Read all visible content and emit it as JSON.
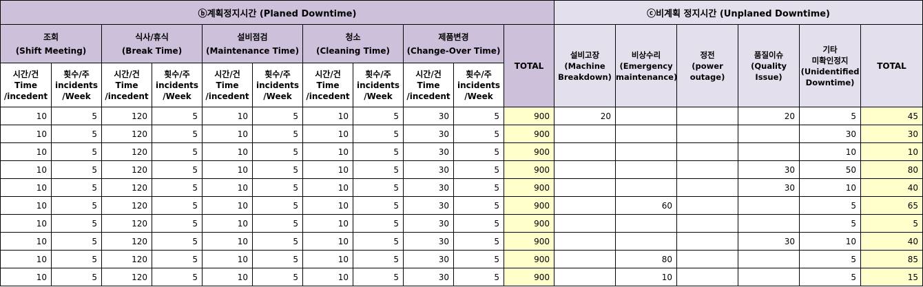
{
  "sections": {
    "planned": "ⓑ계획정지시간 (Planed Downtime)",
    "unplanned": "ⓒ비계획 정지시간 (Unplaned Downtime)"
  },
  "planned_categories": [
    [
      "조회",
      "(Shift Meeting)"
    ],
    [
      "식사/휴식",
      "(Break Time)"
    ],
    [
      "설비점검",
      "(Maintenance Time)"
    ],
    [
      "청소",
      "(Cleaning Time)"
    ],
    [
      "제품변경",
      "(Change-Over Time)"
    ]
  ],
  "sub_headers": {
    "time": [
      "시간/건",
      "Time",
      "/incedent"
    ],
    "count": [
      "횟수/주",
      "incidents",
      "/Week"
    ]
  },
  "total_label": "TOTAL",
  "unplanned_categories": [
    [
      "설비고장",
      "(Machine",
      "Breakdown)"
    ],
    [
      "비상수리",
      "(Emergency",
      "maintenance)"
    ],
    [
      "정전",
      "(power",
      "outage)"
    ],
    [
      "품질이슈",
      "(Quality",
      "Issue)"
    ],
    [
      "기타",
      "미확인정지",
      "(Unidentified",
      "Downtime)"
    ]
  ],
  "rows": [
    [
      "10",
      "5",
      "120",
      "5",
      "10",
      "5",
      "10",
      "5",
      "30",
      "5",
      "900",
      "20",
      "",
      "",
      "20",
      "5",
      "45"
    ],
    [
      "10",
      "5",
      "120",
      "5",
      "10",
      "5",
      "10",
      "5",
      "30",
      "5",
      "900",
      "",
      "",
      "",
      "",
      "30",
      "30"
    ],
    [
      "10",
      "5",
      "120",
      "5",
      "10",
      "5",
      "10",
      "5",
      "30",
      "5",
      "900",
      "",
      "",
      "",
      "",
      "10",
      "10"
    ],
    [
      "10",
      "5",
      "120",
      "5",
      "10",
      "5",
      "10",
      "5",
      "30",
      "5",
      "900",
      "",
      "",
      "",
      "30",
      "50",
      "80"
    ],
    [
      "10",
      "5",
      "120",
      "5",
      "10",
      "5",
      "10",
      "5",
      "30",
      "5",
      "900",
      "",
      "",
      "",
      "30",
      "10",
      "40"
    ],
    [
      "10",
      "5",
      "120",
      "5",
      "10",
      "5",
      "10",
      "5",
      "30",
      "5",
      "900",
      "",
      "60",
      "",
      "",
      "5",
      "65"
    ],
    [
      "10",
      "5",
      "120",
      "5",
      "10",
      "5",
      "10",
      "5",
      "30",
      "5",
      "900",
      "",
      "",
      "",
      "",
      "5",
      "5"
    ],
    [
      "10",
      "5",
      "120",
      "5",
      "10",
      "5",
      "10",
      "5",
      "30",
      "5",
      "900",
      "",
      "",
      "",
      "30",
      "10",
      "40"
    ],
    [
      "10",
      "5",
      "120",
      "5",
      "10",
      "5",
      "10",
      "5",
      "30",
      "5",
      "900",
      "",
      "80",
      "",
      "",
      "5",
      "85"
    ],
    [
      "10",
      "5",
      "120",
      "5",
      "10",
      "5",
      "10",
      "5",
      "30",
      "5",
      "900",
      "",
      "10",
      "",
      "",
      "5",
      "15"
    ]
  ]
}
